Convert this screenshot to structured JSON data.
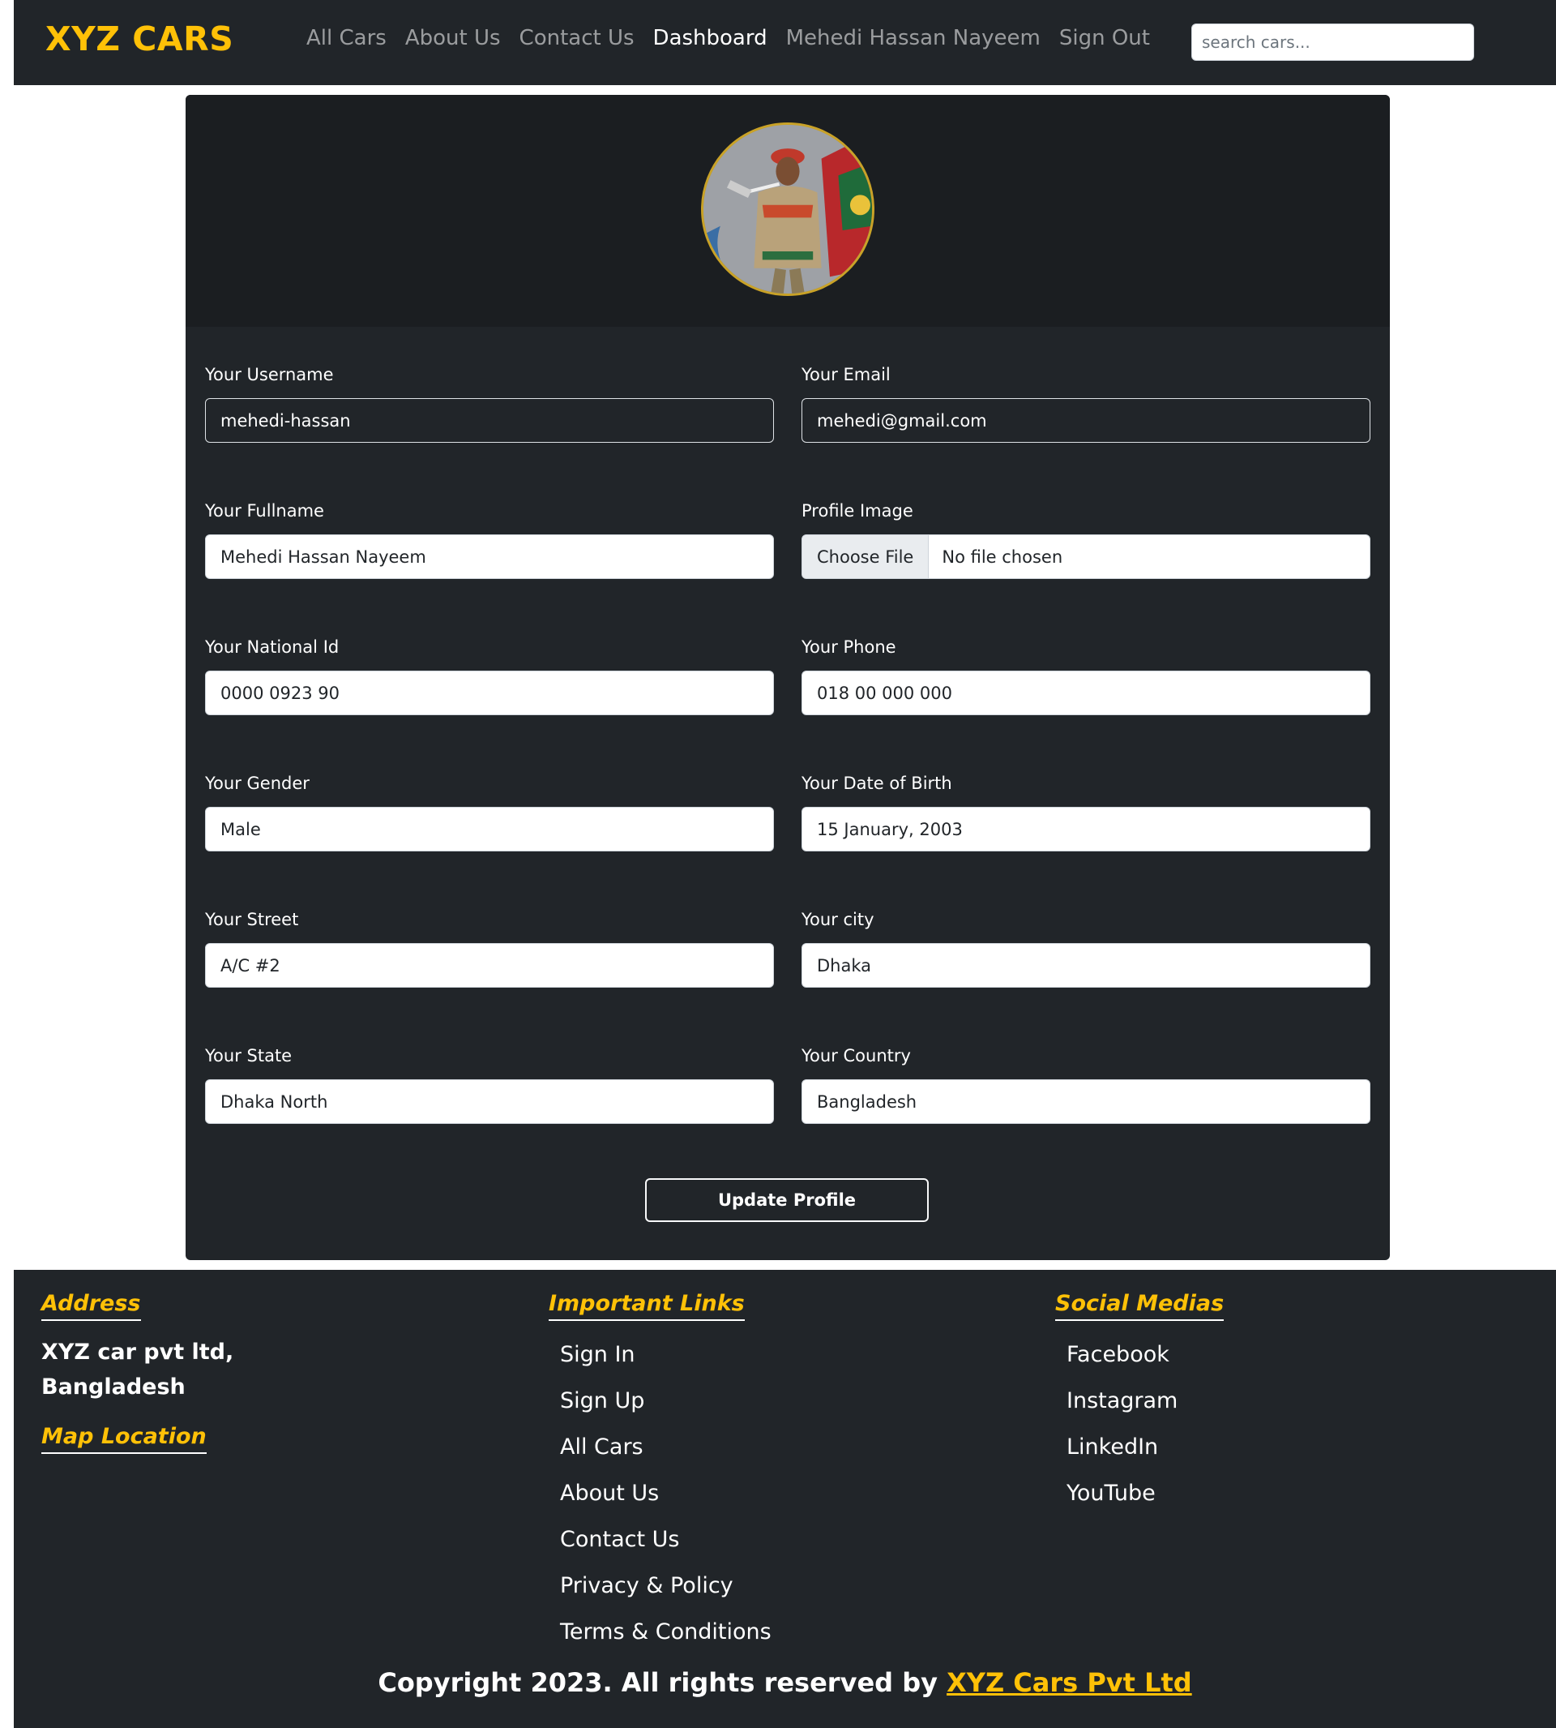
{
  "navbar": {
    "brand": "XYZ CARS",
    "links": [
      {
        "label": "All Cars"
      },
      {
        "label": "About Us"
      },
      {
        "label": "Contact Us"
      },
      {
        "label": "Dashboard"
      },
      {
        "label": "Mehedi Hassan Nayeem"
      },
      {
        "label": "Sign Out"
      }
    ],
    "active_link": "Dashboard",
    "search_placeholder": "search cars..."
  },
  "profile": {
    "avatar": "profile-photo",
    "fields": {
      "username": {
        "label": "Your Username",
        "value": "mehedi-hassan"
      },
      "email": {
        "label": "Your Email",
        "value": "mehedi@gmail.com"
      },
      "fullname": {
        "label": "Your Fullname",
        "value": "Mehedi Hassan Nayeem"
      },
      "profile_image": {
        "label": "Profile Image",
        "button": "Choose File",
        "status": "No file chosen"
      },
      "national_id": {
        "label": "Your National Id",
        "value": "0000 0923 90"
      },
      "phone": {
        "label": "Your Phone",
        "value": "018 00 000 000"
      },
      "gender": {
        "label": "Your Gender",
        "value": "Male"
      },
      "dob": {
        "label": "Your Date of Birth",
        "value": "15 January, 2003"
      },
      "street": {
        "label": "Your Street",
        "value": "A/C #2"
      },
      "city": {
        "label": "Your city",
        "value": "Dhaka"
      },
      "state": {
        "label": "Your State",
        "value": "Dhaka North"
      },
      "country": {
        "label": "Your Country",
        "value": "Bangladesh"
      }
    },
    "update_button": "Update Profile"
  },
  "footer": {
    "address_heading": "Address",
    "address_line1": "XYZ car pvt ltd,",
    "address_line2": "Bangladesh",
    "map_heading": "Map Location",
    "links_heading": "Important Links",
    "links": [
      "Sign In",
      "Sign Up",
      "All Cars",
      "About Us",
      "Contact Us",
      "Privacy & Policy",
      "Terms & Conditions"
    ],
    "social_heading": "Social Medias",
    "social": [
      "Facebook",
      "Instagram",
      "LinkedIn",
      "YouTube"
    ],
    "copyright_text": "Copyright 2023. All rights reserved by ",
    "copyright_link": "XYZ Cars Pvt Ltd"
  },
  "colors": {
    "accent": "#ffc107",
    "dark": "#212529"
  }
}
